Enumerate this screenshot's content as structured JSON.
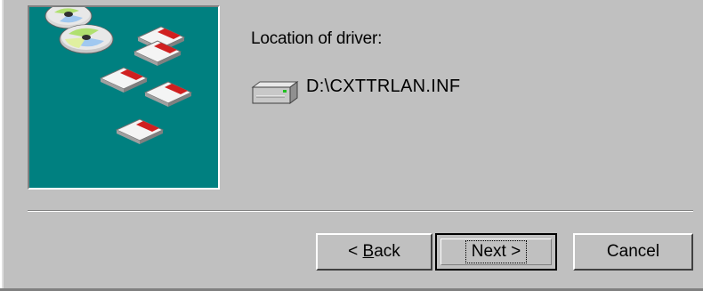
{
  "wizard": {
    "prompt": "Location of driver:",
    "driver_path": "D:\\CXTTRLAN.INF",
    "drive_icon": "hard-drive-icon"
  },
  "buttons": {
    "back_symbol": "< ",
    "back_accel": "B",
    "back_rest": "ack",
    "next": "Next >",
    "cancel": "Cancel"
  },
  "colors": {
    "dialog_bg": "#c0c0c0",
    "wizard_panel": "#008080"
  }
}
